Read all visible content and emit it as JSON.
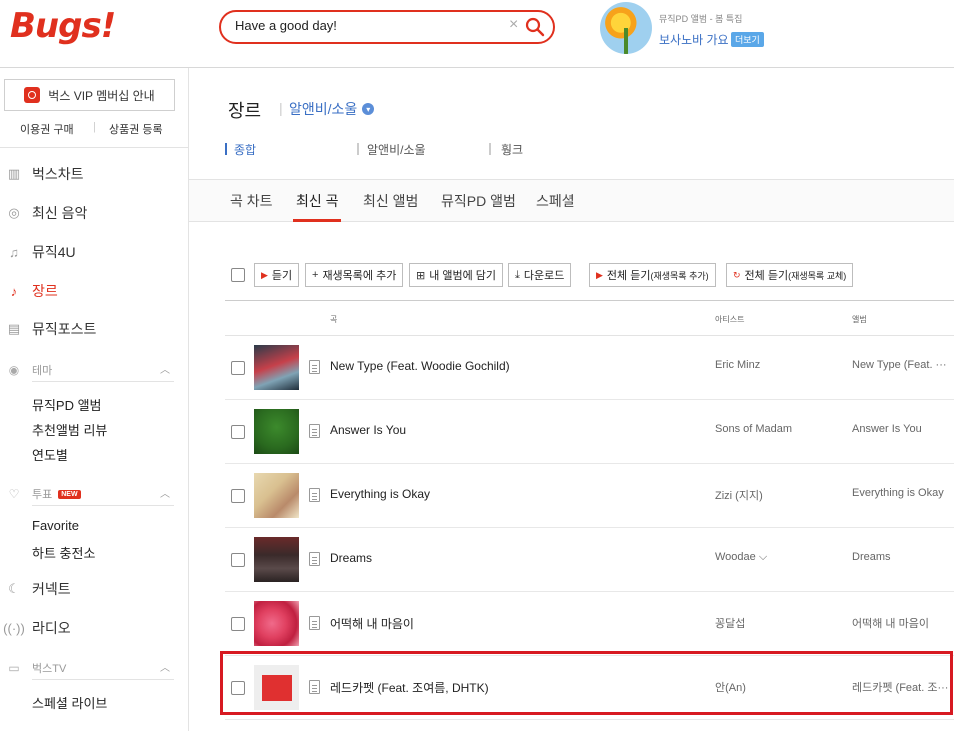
{
  "header": {
    "logo": "Bugs!",
    "search_value": "Have a good day!",
    "search_placeholder": "",
    "clear_icon": "×",
    "promo_small": "뮤직PD 앨범 - 봄 특집",
    "promo_title": "보사노바 가요",
    "promo_more": "더보기"
  },
  "sidebar": {
    "vip_label": "벅스 VIP 멤버십 안내",
    "buy_ticket": "이용권 구매",
    "register_coupon": "상품권 등록",
    "nav": [
      {
        "label": "벅스차트",
        "icon": "chart-icon"
      },
      {
        "label": "최신 음악",
        "icon": "new-music-icon"
      },
      {
        "label": "뮤직4U",
        "icon": "music-note-icon"
      },
      {
        "label": "장르",
        "icon": "guitar-icon"
      },
      {
        "label": "뮤직포스트",
        "icon": "post-icon"
      }
    ],
    "theme_section": "테마",
    "theme_items": [
      "뮤직PD 앨범",
      "추천앨범 리뷰",
      "연도별"
    ],
    "vote_section": "투표",
    "new_badge": "NEW",
    "vote_items": [
      "Favorite",
      "하트 충전소"
    ],
    "connect": "커넥트",
    "radio": "라디오",
    "tv_section": "벅스TV",
    "tv_items": [
      "스페셜 라이브"
    ]
  },
  "main": {
    "genre_title": "장르",
    "genre_sub": "알앤비/소울",
    "genre_dot": "▾",
    "filters": [
      "종합",
      "알앤비/소울",
      "훵크"
    ],
    "tabs": [
      "곡 차트",
      "최신 곡",
      "최신 앨범",
      "뮤직PD 앨범",
      "스페셜"
    ],
    "toolbar": {
      "listen": "듣기",
      "add_playlist": "재생목록에 추가",
      "add_album": "내 앨범에 담기",
      "download": "다운로드",
      "listen_all_add": "전체 듣기",
      "listen_all_add_sub": "(재생목록 추가)",
      "listen_all_replace": "전체 듣기",
      "listen_all_replace_sub": "(재생목록 교체)"
    },
    "columns": {
      "song": "곡",
      "artist": "아티스트",
      "album": "앨범"
    },
    "songs": [
      {
        "title": "New Type (Feat. Woodie Gochild)",
        "artist": "Eric Minz",
        "album": "New Type (Feat. ···"
      },
      {
        "title": "Answer Is You",
        "artist": "Sons of Madam",
        "album": "Answer Is You"
      },
      {
        "title": "Everything is Okay",
        "artist": "Zizi (지지)",
        "album": "Everything is Okay"
      },
      {
        "title": "Dreams",
        "artist": "Woodae ⌵",
        "album": "Dreams"
      },
      {
        "title": "어떡해 내 마음이",
        "artist": "꽁달섭",
        "album": "어떡해 내 마음이"
      },
      {
        "title": "레드카펫 (Feat. 조여름, DHTK)",
        "artist": "안(An)",
        "album": "레드카펫 (Feat. 조···"
      }
    ],
    "highlight_color": "#d71921",
    "accent_color": "#e0301e"
  }
}
